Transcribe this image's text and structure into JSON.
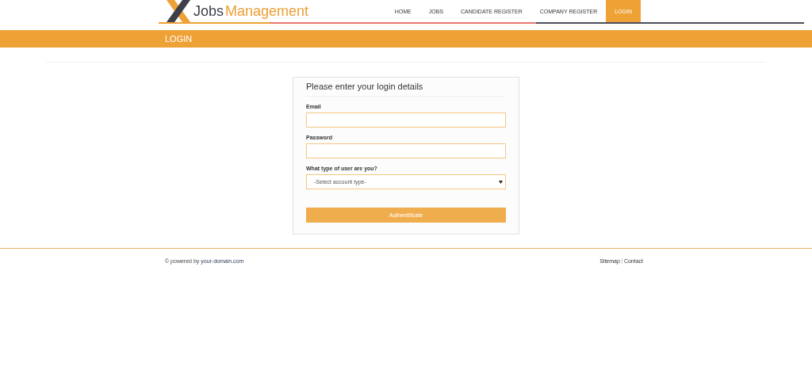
{
  "logo": {
    "first": "Jobs",
    "second": "Management"
  },
  "nav": [
    {
      "label": "HOME",
      "selected": false
    },
    {
      "label": "JOBS",
      "selected": false
    },
    {
      "label": "CANDIDATE REGISTER",
      "selected": false
    },
    {
      "label": "COMPANY REGISTER",
      "selected": false
    },
    {
      "label": "LOGIN",
      "selected": true
    }
  ],
  "page_title": "LOGIN",
  "form": {
    "heading": "Please enter your login details",
    "fields": [
      {
        "kind": "input",
        "label": "Email"
      },
      {
        "kind": "input",
        "label": "Password"
      },
      {
        "kind": "select",
        "label": "What type of user are you?",
        "value": "-Select account type-"
      }
    ],
    "submit": "Authentificate"
  },
  "footer": {
    "text": "© powered by",
    "link": "your-domain.com",
    "links": [
      "Sitemap",
      "Contact"
    ]
  }
}
